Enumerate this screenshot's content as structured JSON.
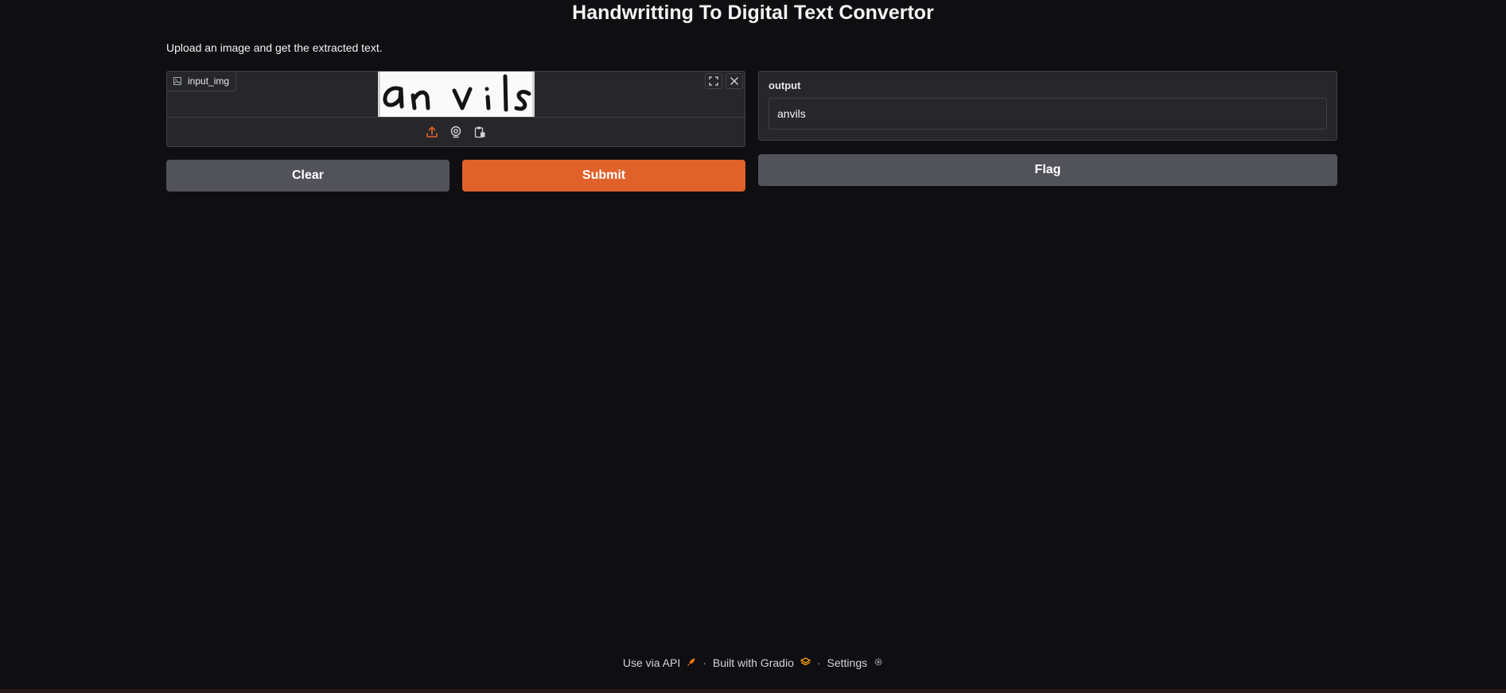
{
  "app": {
    "title": "Handwritting To Digital Text Convertor",
    "description": "Upload an image and get the extracted text."
  },
  "input": {
    "label": "input_img",
    "preview_text": "anvils",
    "fullscreen_icon": "fullscreen-icon",
    "close_icon": "close-icon",
    "sources": [
      "upload-icon",
      "webcam-icon",
      "clipboard-icon"
    ]
  },
  "buttons": {
    "clear": "Clear",
    "submit": "Submit",
    "flag": "Flag"
  },
  "output": {
    "label": "output",
    "value": "anvils"
  },
  "footer": {
    "api": "Use via API",
    "built": "Built with Gradio",
    "settings": "Settings",
    "separator": "·"
  },
  "colors": {
    "background": "#0f0f11",
    "panel": "#27272a",
    "accent": "#e0622a",
    "secondary_button": "#52525b"
  }
}
